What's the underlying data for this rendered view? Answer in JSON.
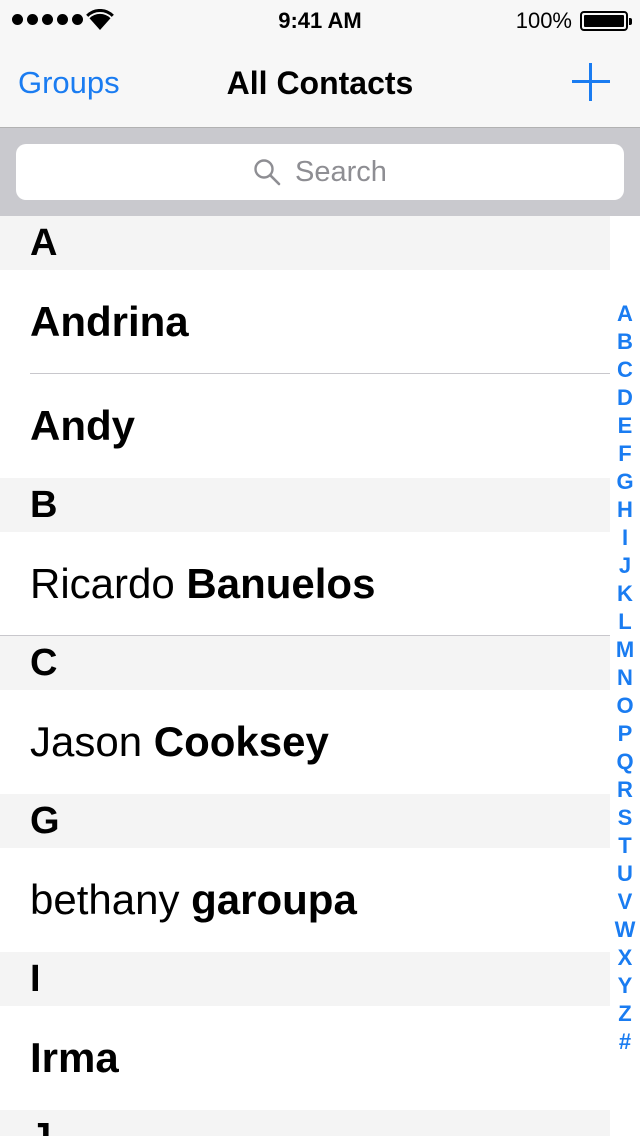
{
  "status_bar": {
    "time": "9:41 AM",
    "battery_percent": "100%",
    "signal_dots": 5,
    "battery_level": 1.0
  },
  "nav": {
    "left_label": "Groups",
    "title": "All Contacts",
    "add_icon": "plus-icon"
  },
  "search": {
    "placeholder": "Search",
    "icon": "search-icon"
  },
  "sections": [
    {
      "letter": "A",
      "contacts": [
        {
          "first": "",
          "last": "Andrina"
        },
        {
          "first": "",
          "last": "Andy"
        }
      ]
    },
    {
      "letter": "B",
      "contacts": [
        {
          "first": "Ricardo",
          "last": "Banuelos"
        }
      ]
    },
    {
      "letter": "C",
      "contacts": [
        {
          "first": "Jason",
          "last": "Cooksey"
        }
      ]
    },
    {
      "letter": "G",
      "contacts": [
        {
          "first": "bethany",
          "last": "garoupa"
        }
      ]
    },
    {
      "letter": "I",
      "contacts": [
        {
          "first": "",
          "last": "Irma"
        }
      ]
    },
    {
      "letter": "J",
      "contacts": []
    }
  ],
  "index_letters": [
    "A",
    "B",
    "C",
    "D",
    "E",
    "F",
    "G",
    "H",
    "I",
    "J",
    "K",
    "L",
    "M",
    "N",
    "O",
    "P",
    "Q",
    "R",
    "S",
    "T",
    "U",
    "V",
    "W",
    "X",
    "Y",
    "Z",
    "#"
  ],
  "colors": {
    "accent": "#1a7cf1",
    "section_bg": "#f4f4f4",
    "search_bg": "#c9c9ce"
  }
}
